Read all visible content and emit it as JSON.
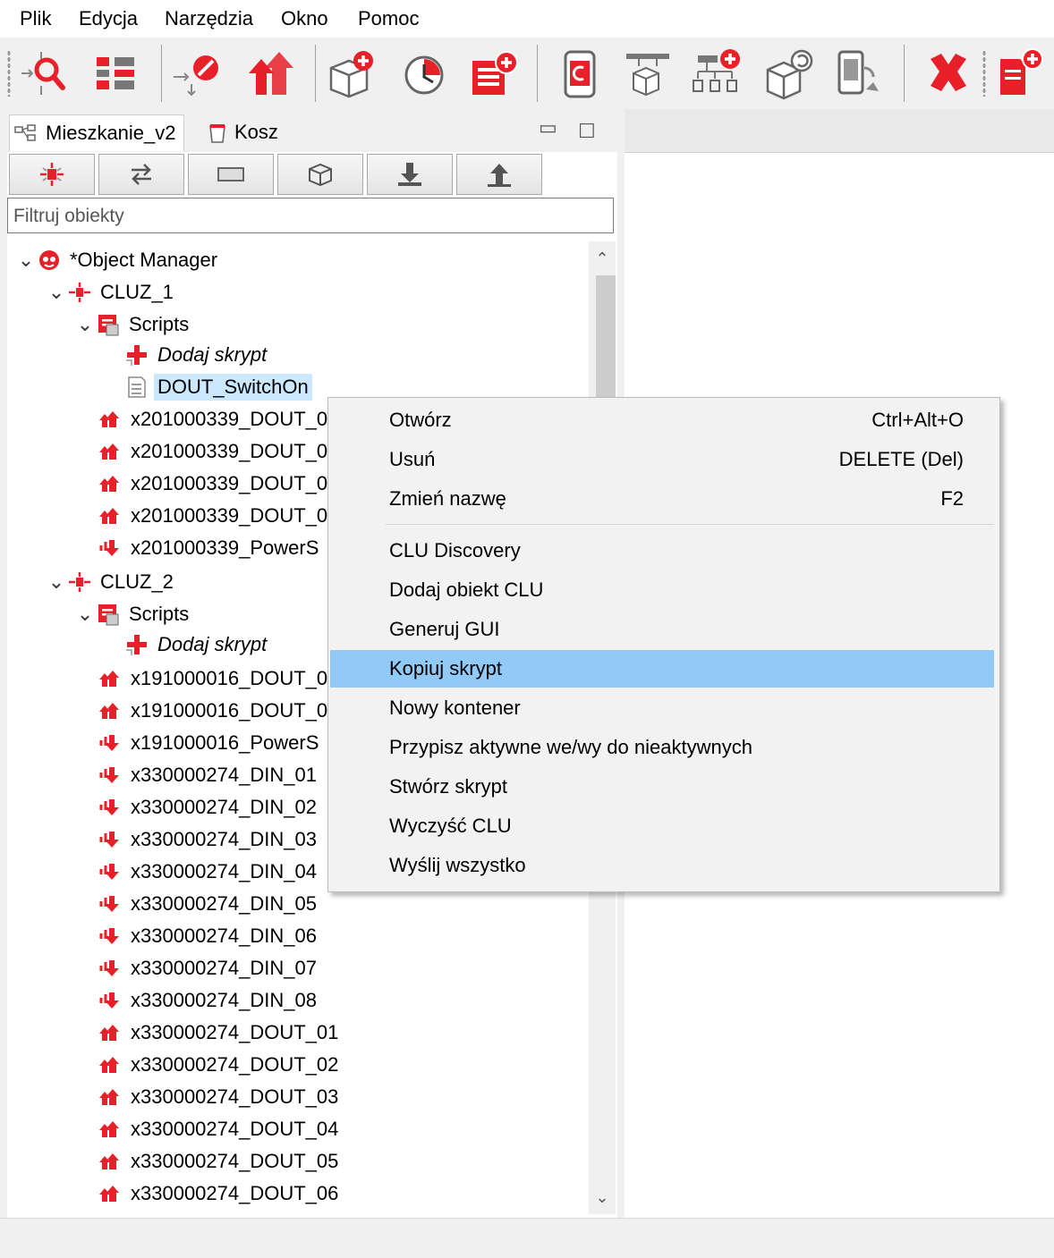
{
  "menubar": {
    "items": [
      "Plik",
      "Edycja",
      "Narzędzia",
      "Okno",
      "Pomoc"
    ]
  },
  "toolbar": {
    "buttons": [
      "find-object-icon",
      "layout-icon",
      "import-icon",
      "export-icon",
      "add-object-icon",
      "timer-icon",
      "add-script-icon",
      "clu-icon",
      "hierarchy-icon",
      "add-hierarchy-icon",
      "refresh-object-icon",
      "device-sync-icon",
      "delete-icon",
      "new-document-icon"
    ]
  },
  "tabs": {
    "project": "Mieszkanie_v2",
    "trash": "Kosz"
  },
  "panel_buttons": [
    "cluster-icon",
    "swap-icon",
    "panel-icon",
    "cube-icon",
    "download-icon",
    "upload-icon"
  ],
  "filter": {
    "placeholder": "Filtruj obiekty"
  },
  "tree": {
    "root": "*Object Manager",
    "items": [
      {
        "label": "CLUZ_1"
      },
      {
        "label": "Scripts"
      },
      {
        "label": "Dodaj skrypt"
      },
      {
        "label": "DOUT_SwitchOn"
      },
      {
        "label": "x201000339_DOUT_0"
      },
      {
        "label": "x201000339_DOUT_0"
      },
      {
        "label": "x201000339_DOUT_0"
      },
      {
        "label": "x201000339_DOUT_0"
      },
      {
        "label": "x201000339_PowerS"
      },
      {
        "label": "CLUZ_2"
      },
      {
        "label": "Scripts"
      },
      {
        "label": "Dodaj skrypt"
      },
      {
        "label": "x191000016_DOUT_0"
      },
      {
        "label": "x191000016_DOUT_0"
      },
      {
        "label": "x191000016_PowerS"
      },
      {
        "label": "x330000274_DIN_01"
      },
      {
        "label": "x330000274_DIN_02"
      },
      {
        "label": "x330000274_DIN_03"
      },
      {
        "label": "x330000274_DIN_04"
      },
      {
        "label": "x330000274_DIN_05"
      },
      {
        "label": "x330000274_DIN_06"
      },
      {
        "label": "x330000274_DIN_07"
      },
      {
        "label": "x330000274_DIN_08"
      },
      {
        "label": "x330000274_DOUT_01"
      },
      {
        "label": "x330000274_DOUT_02"
      },
      {
        "label": "x330000274_DOUT_03"
      },
      {
        "label": "x330000274_DOUT_04"
      },
      {
        "label": "x330000274_DOUT_05"
      },
      {
        "label": "x330000274_DOUT_06"
      }
    ]
  },
  "context_menu": {
    "items": [
      {
        "label": "Otwórz",
        "shortcut": "Ctrl+Alt+O"
      },
      {
        "label": "Usuń",
        "shortcut": "DELETE (Del)"
      },
      {
        "label": "Zmień nazwę",
        "shortcut": "F2"
      },
      {
        "label": "CLU Discovery",
        "shortcut": ""
      },
      {
        "label": "Dodaj obiekt CLU",
        "shortcut": ""
      },
      {
        "label": "Generuj GUI",
        "shortcut": ""
      },
      {
        "label": "Kopiuj skrypt",
        "shortcut": ""
      },
      {
        "label": "Nowy kontener",
        "shortcut": ""
      },
      {
        "label": "Przypisz aktywne we/wy do nieaktywnych",
        "shortcut": ""
      },
      {
        "label": "Stwórz skrypt",
        "shortcut": ""
      },
      {
        "label": "Wyczyść CLU",
        "shortcut": ""
      },
      {
        "label": "Wyślij wszystko",
        "shortcut": ""
      }
    ],
    "highlighted": "Kopiuj skrypt"
  },
  "colors": {
    "accent_red": "#e8202a",
    "selection": "#cce8ff",
    "menu_highlight": "#91c9f7"
  }
}
